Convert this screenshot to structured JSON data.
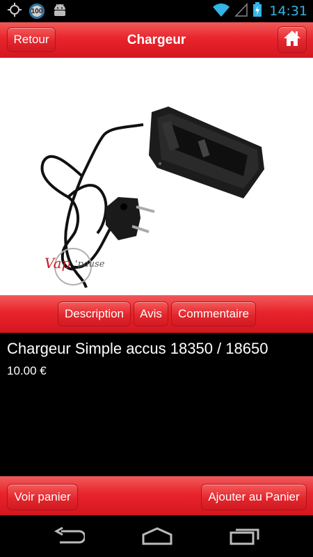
{
  "status_bar": {
    "battery_badge": "100",
    "time": "14:31"
  },
  "header": {
    "back_label": "Retour",
    "title": "Chargeur"
  },
  "tabs": [
    {
      "label": "Description"
    },
    {
      "label": "Avis"
    },
    {
      "label": "Commentaire"
    }
  ],
  "product": {
    "name": "Chargeur Simple accus 18350 / 18650",
    "price": "10.00 €",
    "watermark": "Vap'pause"
  },
  "footer": {
    "view_cart_label": "Voir panier",
    "add_to_cart_label": "Ajouter au Panier"
  },
  "colors": {
    "accent_red": "#e8242c",
    "clock_blue": "#33b5e5"
  }
}
